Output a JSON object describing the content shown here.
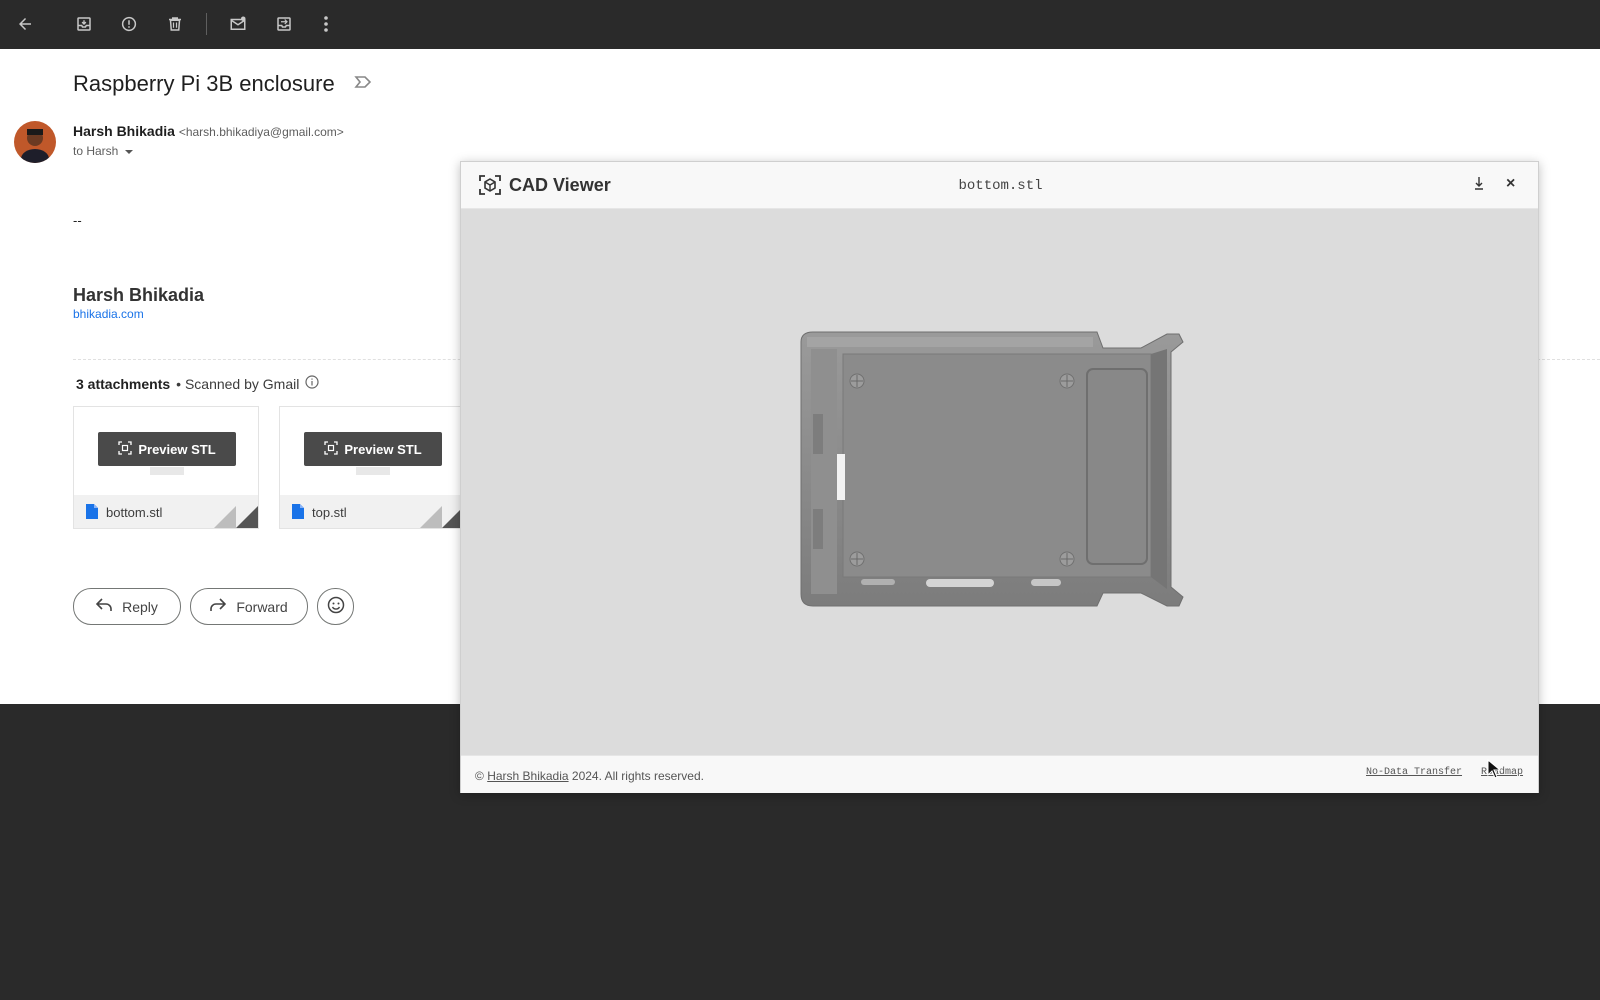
{
  "toolbar": {
    "icons": [
      "back-arrow-icon",
      "archive-icon",
      "report-spam-icon",
      "delete-icon",
      "mark-unread-icon",
      "move-to-icon",
      "more-vert-icon"
    ]
  },
  "email": {
    "subject": "Raspberry Pi 3B enclosure",
    "sender_name": "Harsh Bhikadia",
    "sender_email": "<harsh.bhikadiya@gmail.com>",
    "to_line": "to Harsh",
    "body_dashes": "--",
    "signature_name": "Harsh Bhikadia",
    "signature_link": "bhikadia.com"
  },
  "attachments": {
    "count_label": "3 attachments",
    "scan_label": "• Scanned by Gmail",
    "items": [
      {
        "preview_label": "Preview STL",
        "filename": "bottom.stl"
      },
      {
        "preview_label": "Preview STL",
        "filename": "top.stl"
      }
    ]
  },
  "actions": {
    "reply": "Reply",
    "forward": "Forward"
  },
  "cad_viewer": {
    "title": "CAD Viewer",
    "filename": "bottom.stl",
    "close_symbol": "×",
    "copyright_prefix": "©",
    "copyright_link": "Harsh Bhikadia",
    "copyright_suffix": "2024. All rights reserved.",
    "link_no_data": "No-Data Transfer",
    "link_roadmap": "Roadmap",
    "canvas_bg": "#dcdcdc",
    "model_color": "#8a8a8a"
  }
}
